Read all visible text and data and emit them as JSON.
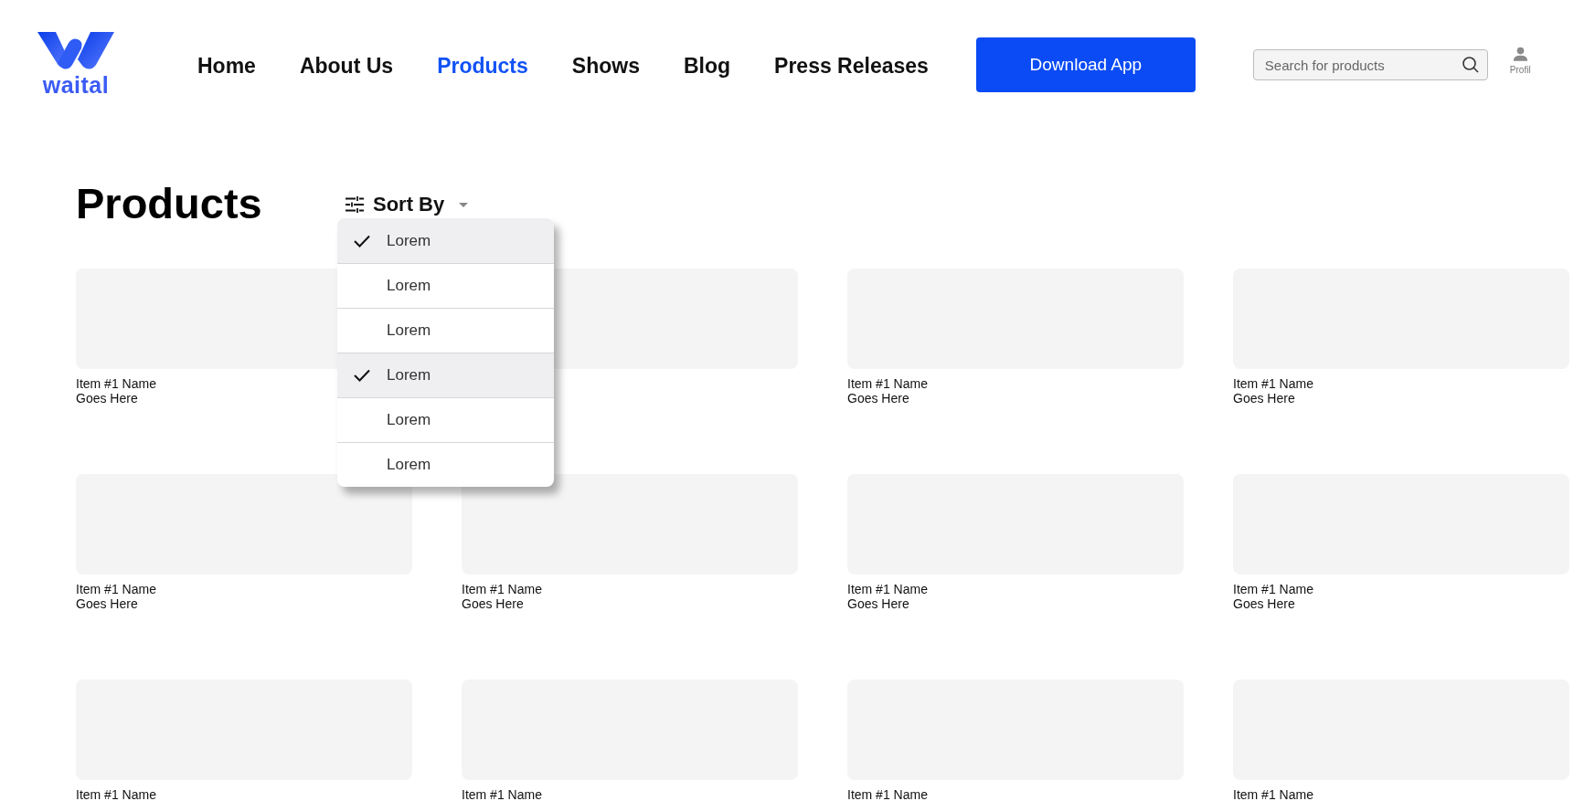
{
  "header": {
    "logo_text": "waital",
    "nav": [
      {
        "label": "Home",
        "selected": false
      },
      {
        "label": "About Us",
        "selected": false
      },
      {
        "label": "Products",
        "selected": true
      },
      {
        "label": "Shows",
        "selected": false
      },
      {
        "label": "Blog",
        "selected": false
      },
      {
        "label": "Press Releases",
        "selected": false
      }
    ],
    "download_button": "Download App",
    "search": {
      "placeholder": "Search for products"
    },
    "profile_label": "Profil"
  },
  "page_title": "Products",
  "sort": {
    "label": "Sort By",
    "options": [
      {
        "label": "Lorem",
        "checked": true
      },
      {
        "label": "Lorem",
        "checked": false
      },
      {
        "label": "Lorem",
        "checked": false
      },
      {
        "label": "Lorem",
        "checked": true
      },
      {
        "label": "Lorem",
        "checked": false
      },
      {
        "label": "Lorem",
        "checked": false
      }
    ]
  },
  "products": [
    {
      "kind": "placeholder",
      "lines": [
        "Item #1 Name",
        "Goes Here"
      ]
    },
    {
      "kind": "placeholder"
    },
    {
      "kind": "placeholder",
      "lines": [
        "Item #1 Name",
        "Goes Here"
      ]
    },
    {
      "kind": "placeholder",
      "lines": [
        "Item #1 Name",
        "Goes Here"
      ]
    },
    {
      "kind": "placeholder",
      "lines": [
        "Item #1 Name",
        "Goes Here"
      ]
    },
    {
      "kind": "placeholder",
      "lines": [
        "Item #1 Name",
        "Goes Here"
      ]
    },
    {
      "kind": "placeholder",
      "lines": [
        "Item #1 Name",
        "Goes Here"
      ]
    },
    {
      "kind": "placeholder",
      "lines": [
        "Item #1 Name",
        "Goes Here"
      ]
    },
    {
      "kind": "placeholder",
      "lines": [
        "Item #1 Name"
      ]
    },
    {
      "kind": "placeholder",
      "lines": [
        "Item #1 Name"
      ]
    },
    {
      "kind": "placeholder",
      "lines": [
        "Item #1 Name"
      ]
    },
    {
      "kind": "placeholder",
      "lines": [
        "Item #1 Name"
      ]
    }
  ]
}
